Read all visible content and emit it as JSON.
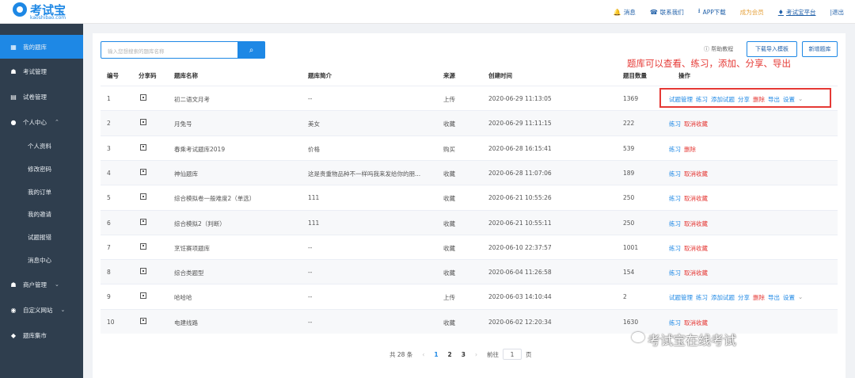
{
  "logo": {
    "name": "考试宝",
    "sub": "kaoshibao.com"
  },
  "topnav": [
    {
      "icon": "bell-icon",
      "glyph": "🔔",
      "label": "消息"
    },
    {
      "icon": "headset-icon",
      "glyph": "☎",
      "label": "联系我们"
    },
    {
      "icon": "download-icon",
      "glyph": "⭳",
      "label": "APP下载"
    },
    {
      "icon": "",
      "glyph": "",
      "label": "成为会员"
    },
    {
      "icon": "diamond-icon",
      "glyph": "♦",
      "label": "考试宝平台"
    },
    {
      "icon": "",
      "glyph": "",
      "label": "|退出"
    }
  ],
  "sidebar": {
    "items": [
      {
        "icon": "grid-icon",
        "glyph": "▦",
        "label": "我的题库"
      },
      {
        "icon": "exam-icon",
        "glyph": "☗",
        "label": "考试管理"
      },
      {
        "icon": "paper-icon",
        "glyph": "▤",
        "label": "试卷管理"
      },
      {
        "icon": "user-icon",
        "glyph": "●",
        "label": "个人中心"
      },
      {
        "icon": "shop-icon",
        "glyph": "☗",
        "label": "商户管理"
      },
      {
        "icon": "globe-icon",
        "glyph": "◉",
        "label": "自定义网站"
      },
      {
        "icon": "box-icon",
        "glyph": "◆",
        "label": "题库集市"
      }
    ],
    "sub_items": [
      "个人资料",
      "修改密码",
      "我的订单",
      "我的邀请",
      "试题报错",
      "消息中心"
    ]
  },
  "toolbar": {
    "search_placeholder": "输入您想搜索的题库名称",
    "help": "帮助教程",
    "download_template": "下载导入模板",
    "new_bank": "新增题库"
  },
  "annotation": "题库可以查看、练习，添加、分享、导出",
  "table": {
    "headers": [
      "编号",
      "分享码",
      "题库名称",
      "题库简介",
      "来源",
      "创建时间",
      "题目数量",
      "操作"
    ],
    "rows": [
      {
        "id": "1",
        "name": "初二语文月考",
        "intro": "--",
        "source": "上传",
        "created": "2020-06-29 11:13:05",
        "count": "1369"
      },
      {
        "id": "2",
        "name": "月兔号",
        "intro": "美女",
        "source": "收藏",
        "created": "2020-06-29 11:11:15",
        "count": "222"
      },
      {
        "id": "3",
        "name": "春乘考试题库2019",
        "intro": "价格",
        "source": "购买",
        "created": "2020-06-28 16:15:41",
        "count": "539"
      },
      {
        "id": "4",
        "name": "神仙题库",
        "intro": "这是贵重物品种不一样吗我来发给你的朋...",
        "source": "收藏",
        "created": "2020-06-28 11:07:06",
        "count": "189"
      },
      {
        "id": "5",
        "name": "综合模拟卷一般难度2（单选）",
        "intro": "111",
        "source": "收藏",
        "created": "2020-06-21 10:55:26",
        "count": "250"
      },
      {
        "id": "6",
        "name": "综合模拟2（判断）",
        "intro": "111",
        "source": "收藏",
        "created": "2020-06-21 10:55:11",
        "count": "250"
      },
      {
        "id": "7",
        "name": "烹饪赛项题库",
        "intro": "--",
        "source": "收藏",
        "created": "2020-06-10 22:37:57",
        "count": "1001"
      },
      {
        "id": "8",
        "name": "综合类题型",
        "intro": "--",
        "source": "收藏",
        "created": "2020-06-04 11:26:58",
        "count": "154"
      },
      {
        "id": "9",
        "name": "哈哈哈",
        "intro": "--",
        "source": "上传",
        "created": "2020-06-03 14:10:44",
        "count": "2"
      },
      {
        "id": "10",
        "name": "电建线路",
        "intro": "--",
        "source": "收藏",
        "created": "2020-06-02 12:20:34",
        "count": "1630"
      }
    ],
    "ops_upload": [
      "试题管理",
      "练习",
      "添加试题",
      "分享",
      "删除",
      "导出",
      "设置",
      "⌄"
    ],
    "ops_collect": [
      "练习",
      "取消收藏"
    ],
    "ops_buy": [
      "练习",
      "删除"
    ]
  },
  "pager": {
    "total": "共 28 条",
    "pages": [
      "1",
      "2",
      "3"
    ],
    "goto_label": "前往",
    "goto_value": "1",
    "goto_suffix": "页",
    "prev": "‹",
    "next": "›"
  },
  "watermark": "考试宝在线考试"
}
